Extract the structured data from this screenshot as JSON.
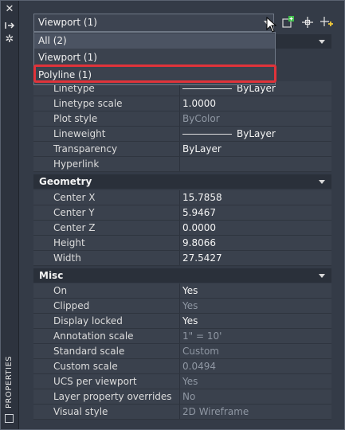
{
  "palette_title": "PROPERTIES",
  "selector": {
    "value": "Viewport (1)",
    "options": [
      "All (2)",
      "Viewport (1)",
      "Polyline (1)"
    ],
    "highlighted_option": "Polyline (1)"
  },
  "toolbar": {
    "quick_select_icon": "quick-select-icon",
    "select_objects_icon": "select-objects-icon",
    "pickadd_icon": "pickadd-toggle-icon"
  },
  "sections": {
    "general_rows": [
      {
        "key": "Linetype",
        "value": "ByLayer",
        "line": true,
        "dim": false
      },
      {
        "key": "Linetype scale",
        "value": "1.0000",
        "line": false,
        "dim": false
      },
      {
        "key": "Plot style",
        "value": "ByColor",
        "line": false,
        "dim": true
      },
      {
        "key": "Lineweight",
        "value": "ByLayer",
        "line": true,
        "dim": false
      },
      {
        "key": "Transparency",
        "value": "ByLayer",
        "line": false,
        "dim": false
      },
      {
        "key": "Hyperlink",
        "value": "",
        "line": false,
        "dim": false
      }
    ],
    "geometry": {
      "title": "Geometry",
      "rows": [
        {
          "key": "Center X",
          "value": "15.7858"
        },
        {
          "key": "Center Y",
          "value": "5.9467"
        },
        {
          "key": "Center Z",
          "value": "0.0000"
        },
        {
          "key": "Height",
          "value": "9.8066"
        },
        {
          "key": "Width",
          "value": "27.5427"
        }
      ]
    },
    "misc": {
      "title": "Misc",
      "rows": [
        {
          "key": "On",
          "value": "Yes",
          "dim": false
        },
        {
          "key": "Clipped",
          "value": "Yes",
          "dim": true
        },
        {
          "key": "Display locked",
          "value": "Yes",
          "dim": false
        },
        {
          "key": "Annotation scale",
          "value": "1\" = 10'",
          "dim": true
        },
        {
          "key": "Standard scale",
          "value": "Custom",
          "dim": true
        },
        {
          "key": "Custom scale",
          "value": "0.0494",
          "dim": true
        },
        {
          "key": "UCS per viewport",
          "value": "Yes",
          "dim": true
        },
        {
          "key": "Layer property overrides",
          "value": "No",
          "dim": true
        },
        {
          "key": "Visual style",
          "value": "2D Wireframe",
          "dim": true
        }
      ]
    }
  }
}
